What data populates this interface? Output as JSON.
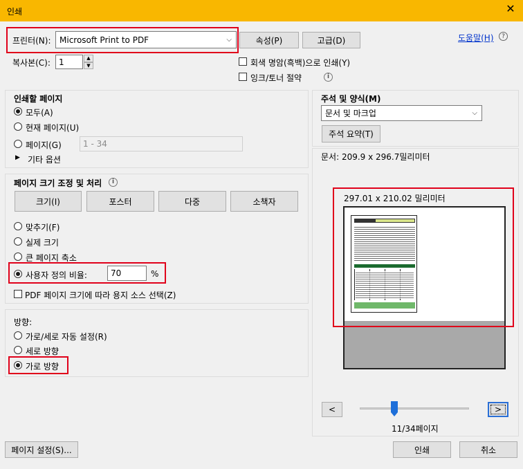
{
  "window": {
    "title": "인쇄",
    "close_icon": "close-icon"
  },
  "printer": {
    "label": "프린터(N):",
    "value": "Microsoft Print to PDF",
    "properties_label": "속성(P)",
    "advanced_label": "고급(D)",
    "help_label": "도움말(H)",
    "copies_label": "복사본(C):",
    "copies_value": "1",
    "grayscale_label": "회색 명암(흑백)으로 인쇄(Y)",
    "grayscale_checked": false,
    "save_ink_label": "잉크/토너 절약",
    "save_ink_checked": false
  },
  "pages_to_print": {
    "heading": "인쇄할 페이지",
    "options": [
      {
        "label": "모두(A)",
        "checked": true
      },
      {
        "label": "현재 페이지(U)",
        "checked": false
      },
      {
        "label": "페이지(G)",
        "checked": false
      }
    ],
    "range_placeholder": "1 - 34",
    "more_options_label": "기타 옵션"
  },
  "page_sizing": {
    "heading": "페이지 크기 조정 및 처리",
    "buttons": [
      "크기(I)",
      "포스터",
      "다중",
      "소책자"
    ],
    "options": [
      {
        "label": "맞추기(F)",
        "checked": false
      },
      {
        "label": "실제 크기",
        "checked": false
      },
      {
        "label": "큰 페이지 축소",
        "checked": false
      }
    ],
    "custom_scale_label": "사용자 정의 비율:",
    "custom_scale_checked": true,
    "custom_scale_value": "70",
    "custom_scale_unit": "%",
    "pdf_paper_source_label": "PDF 페이지 크기에 따라 용지 소스 선택(Z)",
    "pdf_paper_source_checked": false
  },
  "orientation": {
    "heading": "방향:",
    "options": [
      {
        "label": "가로/세로 자동 설정(R)",
        "checked": false
      },
      {
        "label": "세로 방향",
        "checked": false
      },
      {
        "label": "가로 방향",
        "checked": true
      }
    ]
  },
  "comments_forms": {
    "heading": "주석 및 양식(M)",
    "value": "문서 및 마크업",
    "summarize_label": "주석 요약(T)"
  },
  "preview": {
    "document_size": "문서: 209.9 x 296.7밀리미터",
    "paper_size": "297.01 x 210.02 밀리미터",
    "prev_label": "<",
    "next_label": ">",
    "page_indicator": "11/34페이지",
    "page_current": 11,
    "page_total": 34
  },
  "footer": {
    "page_setup_label": "페이지 설정(S)...",
    "print_label": "인쇄",
    "cancel_label": "취소"
  },
  "colors": {
    "titlebar": "#f9b700",
    "highlight": "#e0001a",
    "slider": "#1e6fd9"
  }
}
